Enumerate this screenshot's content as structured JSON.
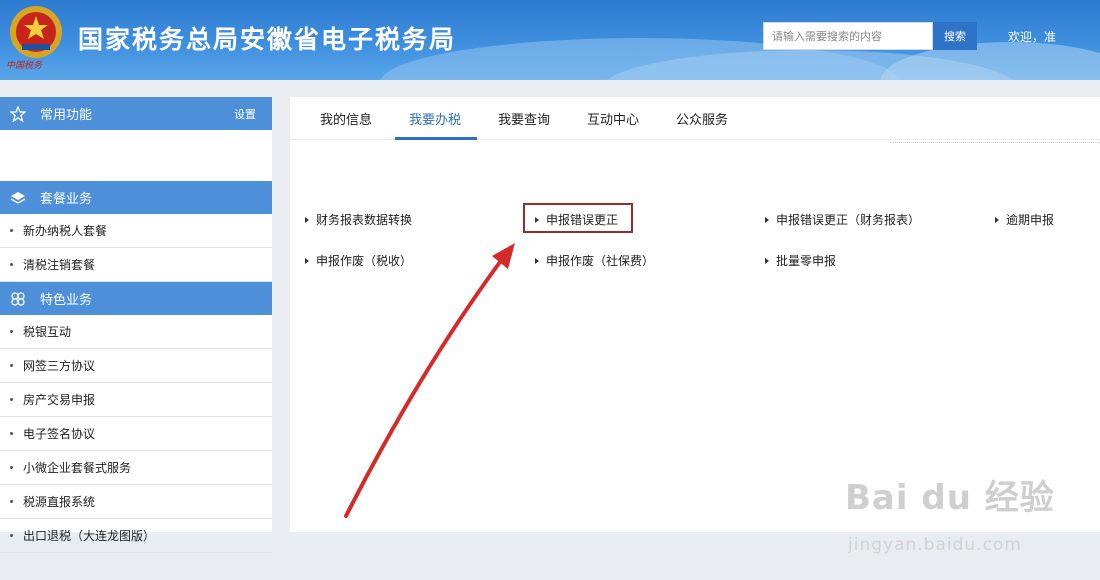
{
  "header": {
    "title": "国家税务总局安徽省电子税务局",
    "emblem_text": "中国税务",
    "search_placeholder": "请输入需要搜索的内容",
    "search_label": "搜索",
    "welcome": "欢迎，准"
  },
  "sidebar": {
    "common": {
      "label": "常用功能",
      "settings": "设置"
    },
    "package": {
      "label": "套餐业务",
      "items": [
        "新办纳税人套餐",
        "清税注销套餐"
      ]
    },
    "special": {
      "label": "特色业务",
      "items": [
        "税银互动",
        "网签三方协议",
        "房产交易申报",
        "电子签名协议",
        "小微企业套餐式服务",
        "税源直报系统",
        "出口退税（大连龙图版）"
      ]
    }
  },
  "tabs": [
    {
      "label": "我的信息"
    },
    {
      "label": "我要办税"
    },
    {
      "label": "我要查询"
    },
    {
      "label": "互动中心"
    },
    {
      "label": "公众服务"
    }
  ],
  "functions": [
    "财务报表数据转换",
    "申报错误更正",
    "申报错误更正（财务报表）",
    "逾期申报",
    "申报作废（税收）",
    "申报作废（社保费）",
    "批量零申报"
  ],
  "annotation": {
    "highlight": "申报错误更正",
    "arrow_color": "#d42a2a"
  },
  "watermark": {
    "main": "Bai du 经验",
    "sub": "jingyan.baidu.com"
  },
  "colors": {
    "accent": "#2f6fbd",
    "sidebar_header": "#4d8fd8",
    "highlight_border": "#9b2a2a"
  }
}
